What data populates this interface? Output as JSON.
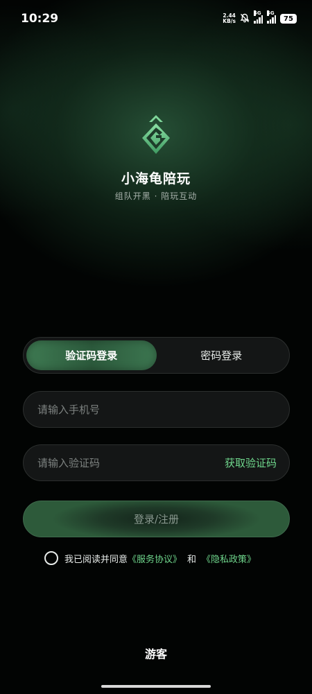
{
  "status_bar": {
    "time": "10:29",
    "net_speed_value": "2.44",
    "net_speed_unit": "KB/s",
    "signal1_label": "5G",
    "signal2_label": "5G",
    "battery": "75"
  },
  "app": {
    "name": "小海龟陪玩",
    "slogan": "组队开黑 · 陪玩互动",
    "logo_icon": "g-diamond-logo",
    "accent_color": "#6fd68c"
  },
  "login_tabs": [
    {
      "label": "验证码登录",
      "active": true
    },
    {
      "label": "密码登录",
      "active": false
    }
  ],
  "phone_field": {
    "placeholder": "请输入手机号",
    "value": ""
  },
  "code_field": {
    "placeholder": "请输入验证码",
    "value": "",
    "get_code_label": "获取验证码"
  },
  "login_button": {
    "label": "登录/注册"
  },
  "agreement": {
    "checked": false,
    "prefix": "我已阅读并同意",
    "service_link": "《服务协议》",
    "and": "和",
    "privacy_link": "《隐私政策》"
  },
  "guest_label": "游客"
}
